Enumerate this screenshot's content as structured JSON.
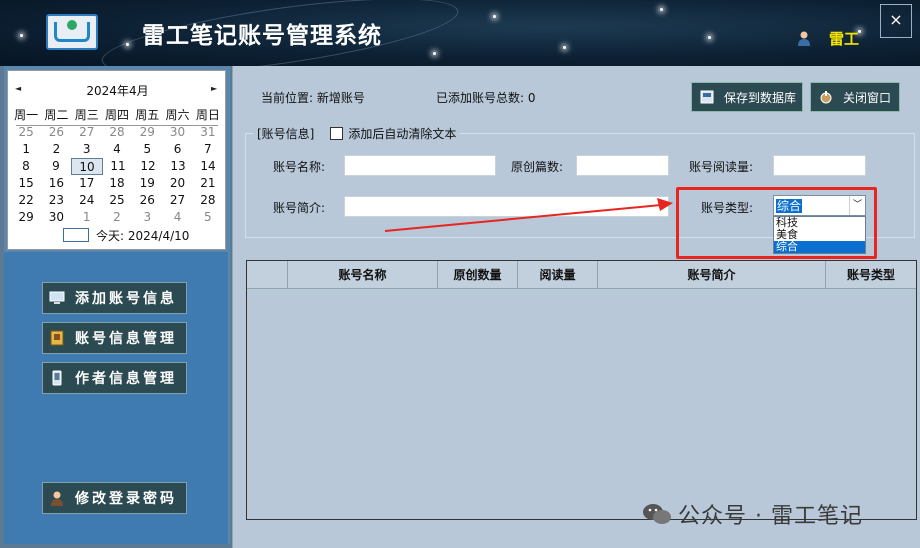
{
  "header": {
    "title": "雷工笔记账号管理系统",
    "user": "雷工",
    "close": "×"
  },
  "calendar": {
    "prev": "◄",
    "next": "►",
    "title": "2024年4月",
    "weekdays": [
      "周一",
      "周二",
      "周三",
      "周四",
      "周五",
      "周六",
      "周日"
    ],
    "weeks": [
      [
        "25",
        "26",
        "27",
        "28",
        "29",
        "30",
        "31"
      ],
      [
        "1",
        "2",
        "3",
        "4",
        "5",
        "6",
        "7"
      ],
      [
        "8",
        "9",
        "10",
        "11",
        "12",
        "13",
        "14"
      ],
      [
        "15",
        "16",
        "17",
        "18",
        "19",
        "20",
        "21"
      ],
      [
        "22",
        "23",
        "24",
        "25",
        "26",
        "27",
        "28"
      ],
      [
        "29",
        "30",
        "1",
        "2",
        "3",
        "4",
        "5"
      ]
    ],
    "today": "今天: 2024/4/10"
  },
  "nav": {
    "add": "添加账号信息",
    "manage": "账号信息管理",
    "author": "作者信息管理",
    "password": "修改登录密码"
  },
  "topbar": {
    "location": "当前位置: 新增账号",
    "count": "已添加账号总数: 0",
    "save": "保存到数据库",
    "close": "关闭窗口"
  },
  "form": {
    "group_title": "[账号信息]",
    "auto_clear": "添加后自动清除文本",
    "name_label": "账号名称:",
    "original_label": "原创篇数:",
    "reads_label": "账号阅读量:",
    "intro_label": "账号简介:",
    "type_label": "账号类型:",
    "type_selected": "综合",
    "type_options": [
      "科技",
      "美食",
      "综合"
    ]
  },
  "table": {
    "headers": [
      "账号名称",
      "原创数量",
      "阅读量",
      "账号简介",
      "账号类型"
    ]
  },
  "watermark": "公众号 · 雷工笔记",
  "colors": {
    "accent_red": "#e8251e",
    "select_blue": "#0a6fd1",
    "user_yellow": "#f5e400"
  }
}
